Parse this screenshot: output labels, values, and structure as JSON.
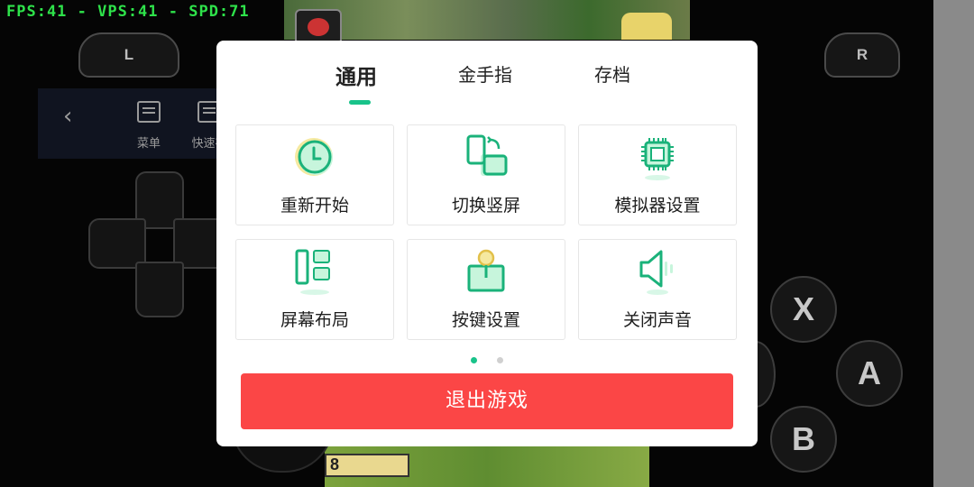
{
  "overlay": {
    "fps_readout": "FPS:41 - VPS:41 - SPD:71",
    "shoulder_left": "L",
    "shoulder_right": "R",
    "toolbar": {
      "menu_label": "菜单",
      "quicksave_label": "快速存"
    },
    "face_buttons": {
      "x": "X",
      "a": "A",
      "b": "B"
    },
    "game_rank": "8"
  },
  "dialog": {
    "tabs": [
      {
        "label": "通用",
        "active": true
      },
      {
        "label": "金手指",
        "active": false
      },
      {
        "label": "存档",
        "active": false
      }
    ],
    "options": [
      {
        "label": "重新开始",
        "icon": "clock-icon"
      },
      {
        "label": "切换竖屏",
        "icon": "rotate-screen-icon"
      },
      {
        "label": "模拟器设置",
        "icon": "chip-icon"
      },
      {
        "label": "屏幕布局",
        "icon": "layout-icon"
      },
      {
        "label": "按键设置",
        "icon": "joystick-icon"
      },
      {
        "label": "关闭声音",
        "icon": "speaker-icon"
      }
    ],
    "pages": {
      "current": 1,
      "total": 2
    },
    "exit_button": "退出游戏",
    "colors": {
      "accent": "#19c38a",
      "danger": "#fb4646",
      "icon_fill": "#c7f5dc",
      "icon_stroke": "#1ab27a"
    }
  }
}
